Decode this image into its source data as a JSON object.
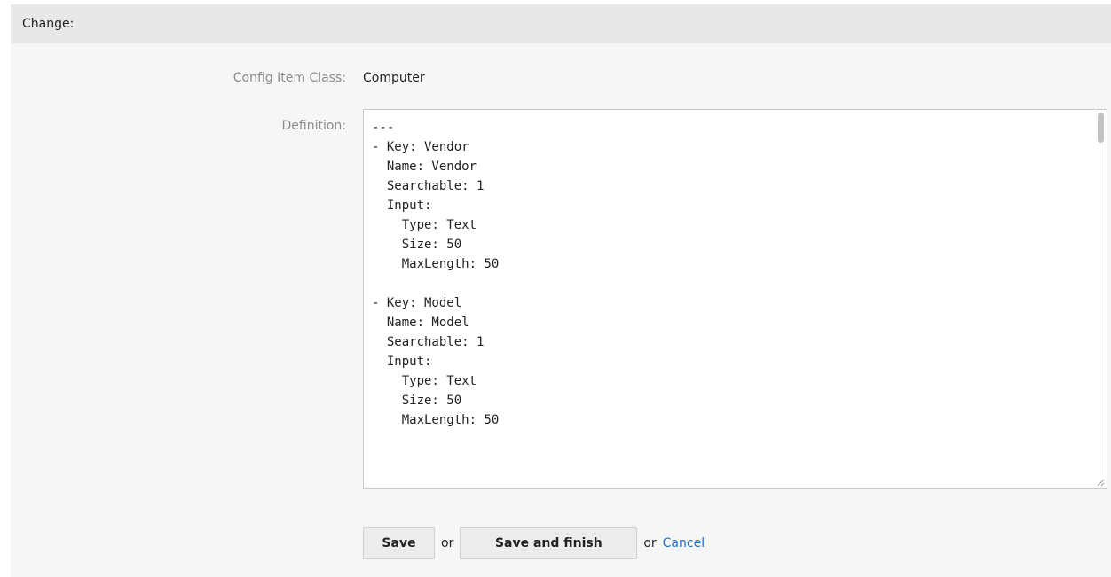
{
  "header": {
    "title": "Change:"
  },
  "form": {
    "class_label": "Config Item Class:",
    "class_value": "Computer",
    "definition_label": "Definition:",
    "definition_text": "---\n- Key: Vendor\n  Name: Vendor\n  Searchable: 1\n  Input:\n    Type: Text\n    Size: 50\n    MaxLength: 50\n\n- Key: Model\n  Name: Model\n  Searchable: 1\n  Input:\n    Type: Text\n    Size: 50\n    MaxLength: 50"
  },
  "actions": {
    "save_label": "Save",
    "or_1": "or",
    "save_finish_label": "Save and finish",
    "or_2": "or",
    "cancel_label": "Cancel"
  },
  "colors": {
    "header_bg": "#e8e8e8",
    "panel_bg": "#f6f6f6",
    "label_gray": "#8c8c8c",
    "link_blue": "#1a73c9",
    "button_bg": "#ececec"
  }
}
